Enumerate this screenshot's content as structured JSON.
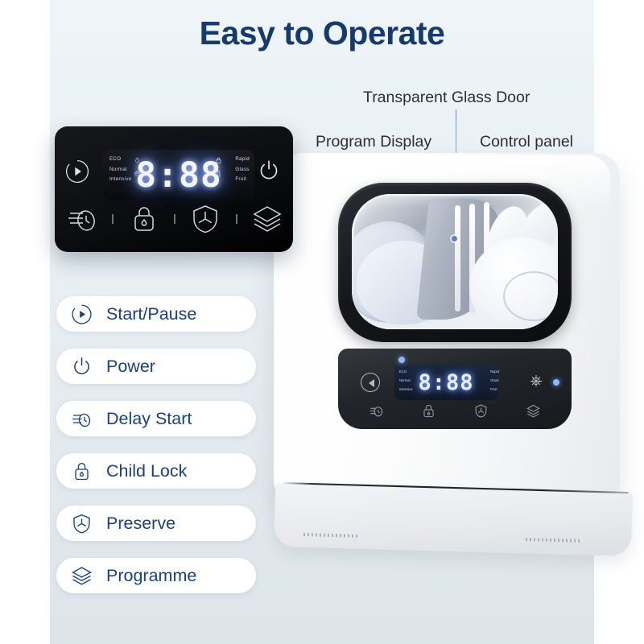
{
  "page": {
    "title": "Easy to Operate",
    "title_color": "#173a6e",
    "accent_color": "#1d4076",
    "background_color": "#e9f1f4"
  },
  "callouts": [
    {
      "id": "transparent-glass-door",
      "label": "Transparent Glass Door"
    },
    {
      "id": "program-display",
      "label": "Program Display"
    },
    {
      "id": "control-panel",
      "label": "Control panel"
    }
  ],
  "control_panel": {
    "display_value": "8:88",
    "program_labels_left": [
      "ECO",
      "Normal",
      "Intensive"
    ],
    "program_labels_right": [
      "Rapid",
      "Glass",
      "Fruit"
    ],
    "left_button": "play-pause",
    "right_button": "power",
    "icon_row": [
      "delay-start",
      "child-lock",
      "preserve",
      "programme"
    ]
  },
  "product_panel": {
    "display_value": "8:88",
    "program_labels_left": [
      "ECO",
      "Normal",
      "Intensive"
    ],
    "program_labels_right": [
      "Rapid",
      "Glass",
      "Fruit"
    ]
  },
  "features": [
    {
      "icon": "play-pause-icon",
      "label": "Start/Pause"
    },
    {
      "icon": "power-icon",
      "label": "Power"
    },
    {
      "icon": "delay-start-icon",
      "label": "Delay Start"
    },
    {
      "icon": "child-lock-icon",
      "label": "Child Lock"
    },
    {
      "icon": "preserve-icon",
      "label": "Preserve"
    },
    {
      "icon": "programme-icon",
      "label": "Programme"
    }
  ]
}
